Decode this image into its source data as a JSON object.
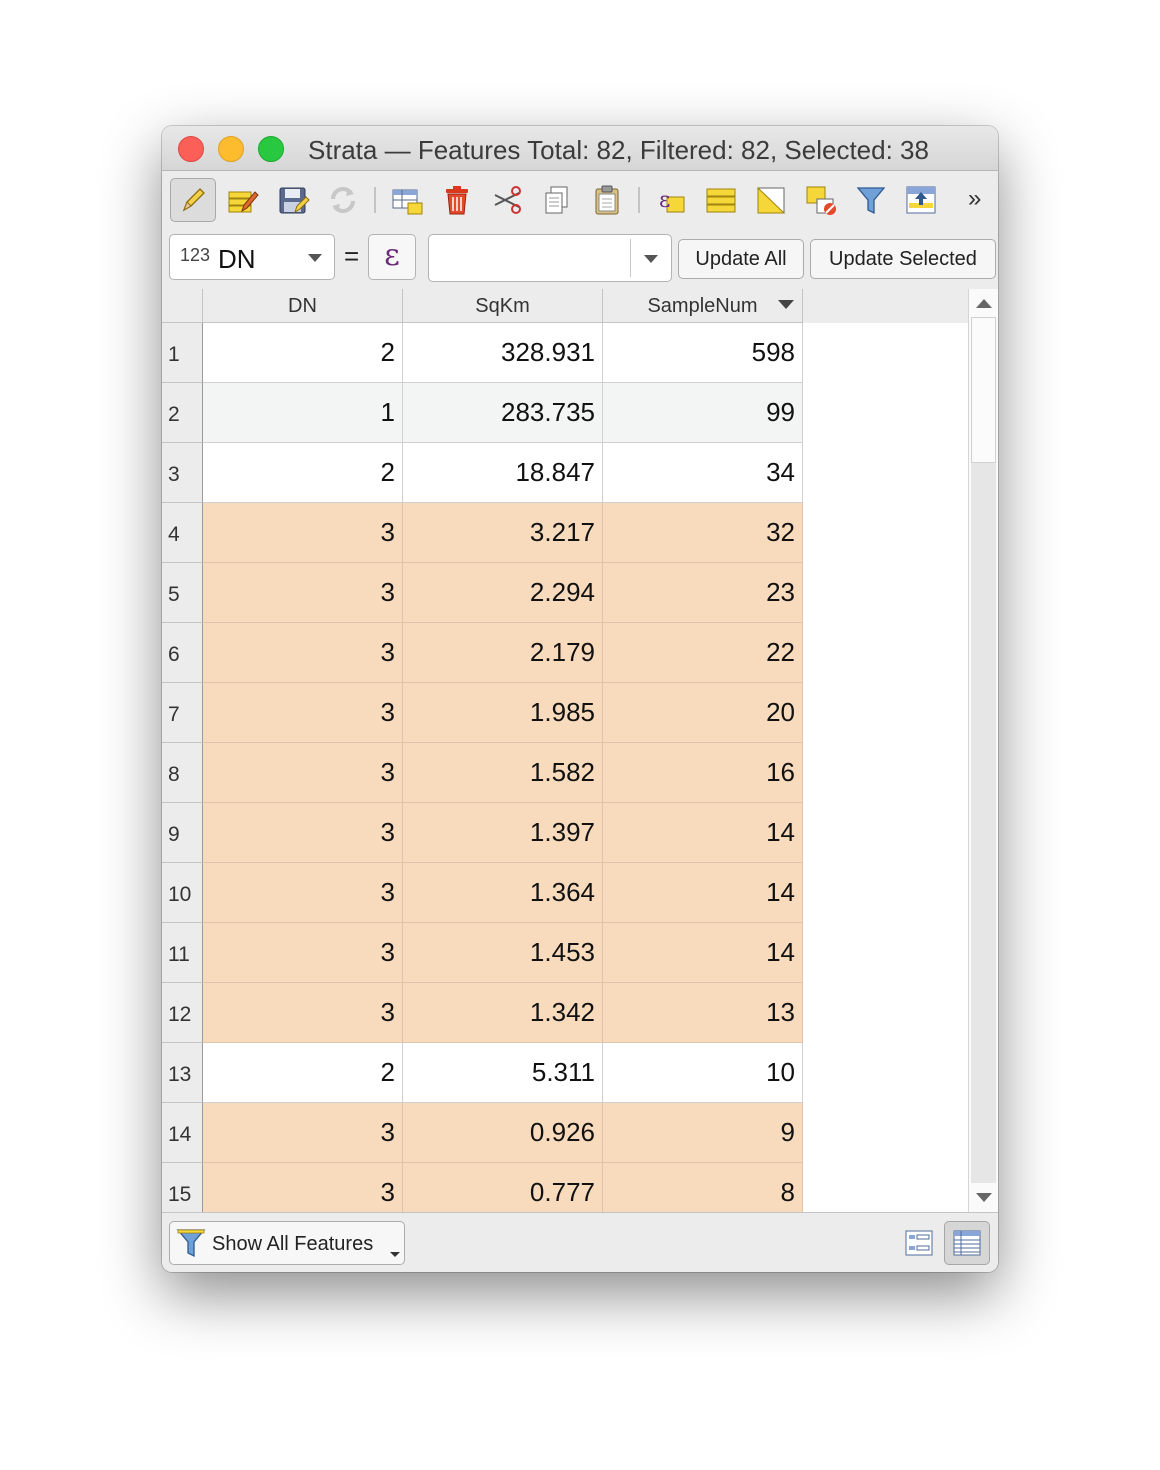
{
  "window": {
    "title": "Strata — Features Total: 82, Filtered: 82, Selected: 38"
  },
  "toolbar": {
    "buttons": [
      {
        "name": "toggle-editing-icon",
        "active": true
      },
      {
        "name": "toggle-multi-edit-icon"
      },
      {
        "name": "save-edits-icon"
      },
      {
        "name": "reload-table-icon"
      },
      {
        "name": "add-feature-icon"
      },
      {
        "name": "delete-selected-icon"
      },
      {
        "name": "cut-icon"
      },
      {
        "name": "copy-icon"
      },
      {
        "name": "paste-icon"
      },
      {
        "name": "select-by-expression-icon"
      },
      {
        "name": "select-all-icon"
      },
      {
        "name": "invert-selection-icon"
      },
      {
        "name": "deselect-all-icon"
      },
      {
        "name": "move-selection-to-top-icon"
      },
      {
        "name": "pan-map-to-selected-icon"
      }
    ],
    "overflow_label": "»"
  },
  "field_calc": {
    "field_type": "123",
    "field_name": "DN",
    "equals": "=",
    "expression_icon": "ε",
    "expression_value": "",
    "update_all_label": "Update All",
    "update_selected_label": "Update Selected"
  },
  "table": {
    "columns": [
      "DN",
      "SqKm",
      "SampleNum"
    ],
    "sorted_column": "SampleNum",
    "sort_direction": "descending",
    "rows": [
      {
        "n": "1",
        "DN": "2",
        "SqKm": "328.931",
        "SampleNum": "598",
        "selected": false
      },
      {
        "n": "2",
        "DN": "1",
        "SqKm": "283.735",
        "SampleNum": "99",
        "selected": false
      },
      {
        "n": "3",
        "DN": "2",
        "SqKm": "18.847",
        "SampleNum": "34",
        "selected": false
      },
      {
        "n": "4",
        "DN": "3",
        "SqKm": "3.217",
        "SampleNum": "32",
        "selected": true
      },
      {
        "n": "5",
        "DN": "3",
        "SqKm": "2.294",
        "SampleNum": "23",
        "selected": true
      },
      {
        "n": "6",
        "DN": "3",
        "SqKm": "2.179",
        "SampleNum": "22",
        "selected": true
      },
      {
        "n": "7",
        "DN": "3",
        "SqKm": "1.985",
        "SampleNum": "20",
        "selected": true
      },
      {
        "n": "8",
        "DN": "3",
        "SqKm": "1.582",
        "SampleNum": "16",
        "selected": true
      },
      {
        "n": "9",
        "DN": "3",
        "SqKm": "1.397",
        "SampleNum": "14",
        "selected": true
      },
      {
        "n": "10",
        "DN": "3",
        "SqKm": "1.364",
        "SampleNum": "14",
        "selected": true
      },
      {
        "n": "11",
        "DN": "3",
        "SqKm": "1.453",
        "SampleNum": "14",
        "selected": true
      },
      {
        "n": "12",
        "DN": "3",
        "SqKm": "1.342",
        "SampleNum": "13",
        "selected": true
      },
      {
        "n": "13",
        "DN": "2",
        "SqKm": "5.311",
        "SampleNum": "10",
        "selected": false
      },
      {
        "n": "14",
        "DN": "3",
        "SqKm": "0.926",
        "SampleNum": "9",
        "selected": true
      },
      {
        "n": "15",
        "DN": "3",
        "SqKm": "0.777",
        "SampleNum": "8",
        "selected": true
      }
    ]
  },
  "bottom": {
    "filter_label": "Show All Features",
    "filter_icon": "funnel-icon",
    "view_buttons": [
      "form-view-icon",
      "table-view-icon"
    ]
  },
  "colors": {
    "selected_row": "#f8dabd",
    "alt_row": "#f3f4f4",
    "close": "#fc5f57",
    "minimize": "#fdbc2e",
    "maximize": "#28c840"
  }
}
